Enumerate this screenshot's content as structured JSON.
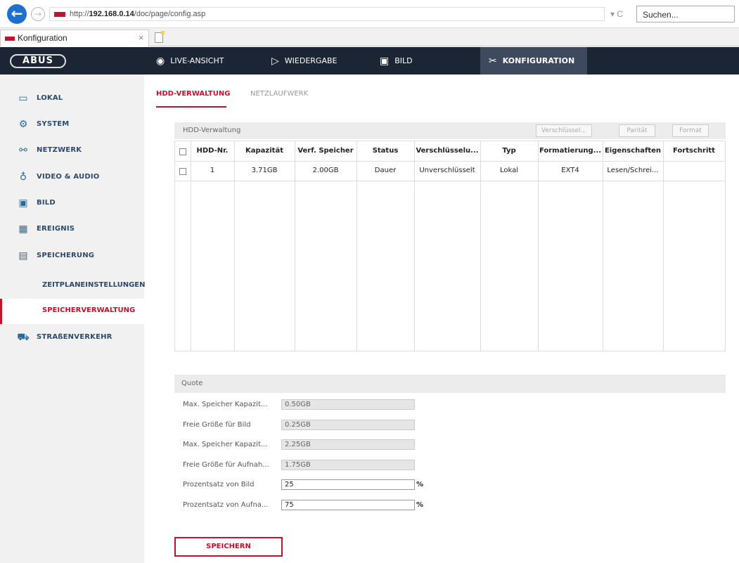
{
  "browser": {
    "url_prefix": "http://",
    "url_host": "192.168.0.14",
    "url_path": "/doc/page/config.asp",
    "url_controls": "▾ C",
    "search_placeholder": "Suchen...",
    "tab_title": "Konfiguration",
    "tab_close": "×"
  },
  "header": {
    "logo": "ABUS",
    "nav": [
      {
        "label": "LIVE-ANSICHT",
        "icon": "eye-icon"
      },
      {
        "label": "WIEDERGABE",
        "icon": "play-icon"
      },
      {
        "label": "BILD",
        "icon": "image-icon"
      },
      {
        "label": "KONFIGURATION",
        "icon": "tools-icon",
        "active": true
      }
    ]
  },
  "sidebar": {
    "items": [
      {
        "label": "LOKAL",
        "icon": "monitor-icon"
      },
      {
        "label": "SYSTEM",
        "icon": "gear-icon"
      },
      {
        "label": "NETZWERK",
        "icon": "network-icon"
      },
      {
        "label": "VIDEO & AUDIO",
        "icon": "microphone-icon"
      },
      {
        "label": "BILD",
        "icon": "image-icon"
      },
      {
        "label": "EREIGNIS",
        "icon": "event-icon"
      },
      {
        "label": "SPEICHERUNG",
        "icon": "storage-icon"
      }
    ],
    "subitems": [
      {
        "label": "ZEITPLANEINSTELLUNGEN"
      },
      {
        "label": "SPEICHERVERWALTUNG",
        "active": true
      }
    ],
    "last_item": {
      "label": "STRAßENVERKEHR",
      "icon": "traffic-icon"
    }
  },
  "content": {
    "tabs": [
      {
        "label": "HDD-VERWALTUNG",
        "active": true
      },
      {
        "label": "NETZLAUFWERK",
        "active": false
      }
    ],
    "hdd_panel": {
      "title": "HDD-Verwaltung",
      "buttons": [
        "Verschlüssel...",
        "Parität",
        "Format"
      ],
      "columns": [
        "HDD-Nr.",
        "Kapazität",
        "Verf. Speicher",
        "Status",
        "Verschlüsselu...",
        "Typ",
        "Formatierung...",
        "Eigenschaften",
        "Fortschritt"
      ],
      "rows": [
        [
          "1",
          "3.71GB",
          "2.00GB",
          "Dauer",
          "Unverschlüsselt",
          "Lokal",
          "EXT4",
          "Lesen/Schrei...",
          ""
        ]
      ]
    },
    "quota": {
      "title": "Quote",
      "fields": [
        {
          "label": "Max. Speicher Kapazit...",
          "value": "0.50GB",
          "unit": ""
        },
        {
          "label": "Freie Größe für Bild",
          "value": "0.25GB",
          "unit": ""
        },
        {
          "label": "Max. Speicher Kapazit...",
          "value": "2.25GB",
          "unit": ""
        },
        {
          "label": "Freie Größe für Aufnah...",
          "value": "1.75GB",
          "unit": ""
        },
        {
          "label": "Prozentsatz von Bild",
          "value": "25",
          "unit": "%"
        },
        {
          "label": "Prozentsatz von Aufna...",
          "value": "75",
          "unit": "%"
        }
      ]
    },
    "save_label": "SPEICHERN"
  },
  "colors": {
    "accent": "#c8102e",
    "header_bg": "#1c2534",
    "sidebar_text": "#2a4a70"
  }
}
